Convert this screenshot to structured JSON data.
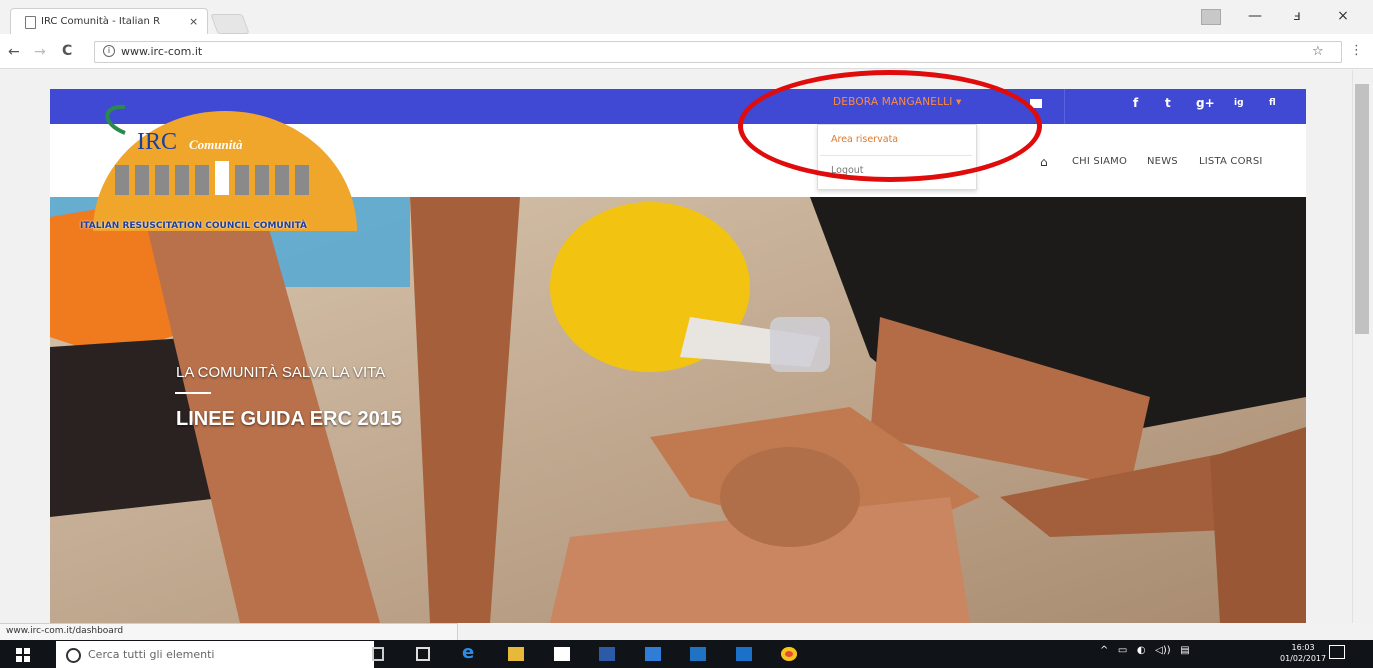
{
  "browser": {
    "tab_title": "IRC Comunità - Italian R",
    "tab_close": "×",
    "url": "www.irc-com.it",
    "status_url": "www.irc-com.it/dashboard",
    "nav": {
      "back": "←",
      "forward": "→",
      "reload": "C"
    },
    "window": {
      "minimize": "—",
      "restore": "ⅎ",
      "close": "×"
    },
    "star": "☆",
    "menu": "⋮"
  },
  "site": {
    "user_menu": {
      "label": "DEBORA MANGANELLI",
      "caret": "▾",
      "items": [
        "Area riservata",
        "Logout"
      ]
    },
    "social_icons": [
      "f",
      "t",
      "g+",
      "ig",
      "fl"
    ],
    "logo": {
      "title_irc": "IRC",
      "title_comunita": "Comunità",
      "subtitle": "ITALIAN RESUSCITATION COUNCIL COMUNITÀ"
    },
    "nav_links": [
      "CHI SIAMO",
      "NEWS",
      "LISTA CORSI"
    ],
    "hero": {
      "line1": "LA COMUNITÀ SALVA LA VITA",
      "line2": "LINEE GUIDA ERC 2015"
    }
  },
  "taskbar": {
    "search_placeholder": "Cerca tutti gli elementi",
    "time": "16:03",
    "date": "01/02/2017"
  },
  "colors": {
    "topbar": "#3f49d4",
    "accent_orange": "#ff8a3d",
    "annotation_red": "#e00b0b"
  }
}
